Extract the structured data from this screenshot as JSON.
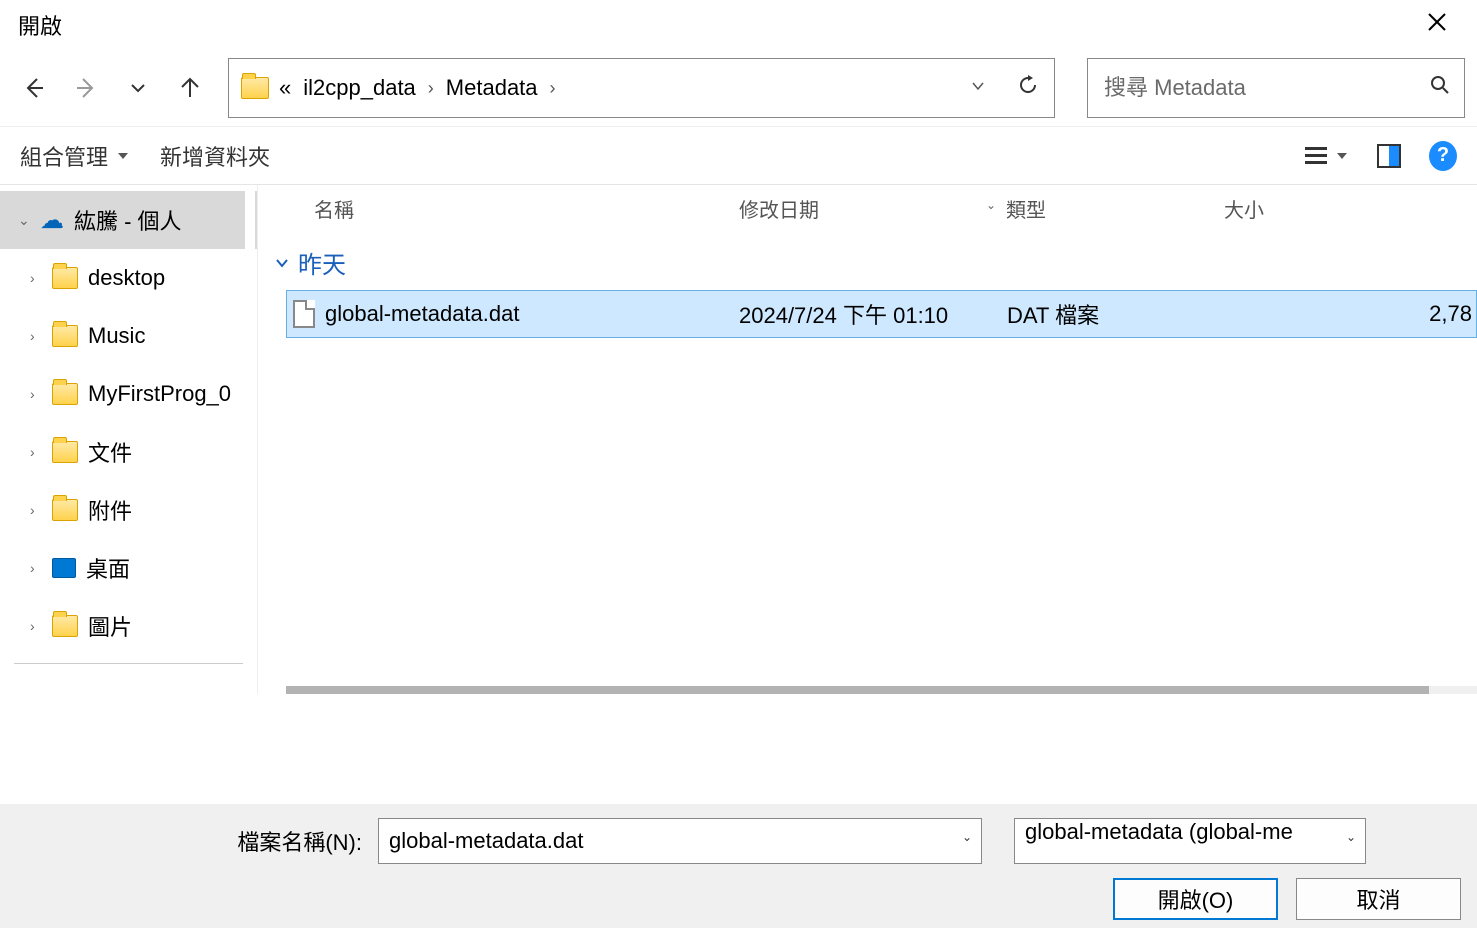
{
  "title": "開啟",
  "breadcrumb": {
    "prefix": "«",
    "parts": [
      "il2cpp_data",
      "Metadata"
    ]
  },
  "search_placeholder": "搜尋 Metadata",
  "toolbar": {
    "organize": "組合管理",
    "new_folder": "新增資料夾"
  },
  "sidebar": {
    "items": [
      {
        "label": "紘騰 - 個人",
        "icon": "cloud",
        "level": 1,
        "expanded": true,
        "selected": true
      },
      {
        "label": "desktop",
        "icon": "folder",
        "level": 2,
        "expanded": false
      },
      {
        "label": "Music",
        "icon": "folder",
        "level": 2,
        "expanded": false
      },
      {
        "label": "MyFirstProg_0",
        "icon": "folder",
        "level": 2,
        "expanded": false
      },
      {
        "label": "文件",
        "icon": "folder",
        "level": 2,
        "expanded": false
      },
      {
        "label": "附件",
        "icon": "folder",
        "level": 2,
        "expanded": false
      },
      {
        "label": "桌面",
        "icon": "desktop",
        "level": 2,
        "expanded": false
      },
      {
        "label": "圖片",
        "icon": "folder",
        "level": 2,
        "expanded": false
      }
    ]
  },
  "columns": {
    "name": "名稱",
    "date": "修改日期",
    "type": "類型",
    "size": "大小"
  },
  "group_header": "昨天",
  "files": [
    {
      "name": "global-metadata.dat",
      "date": "2024/7/24 下午 01:10",
      "type": "DAT 檔案",
      "size": "2,78"
    }
  ],
  "filename_label": "檔案名稱(N):",
  "filename_value": "global-metadata.dat",
  "filter_value": "global-metadata (global-me",
  "open_btn": "開啟(O)",
  "cancel_btn": "取消"
}
